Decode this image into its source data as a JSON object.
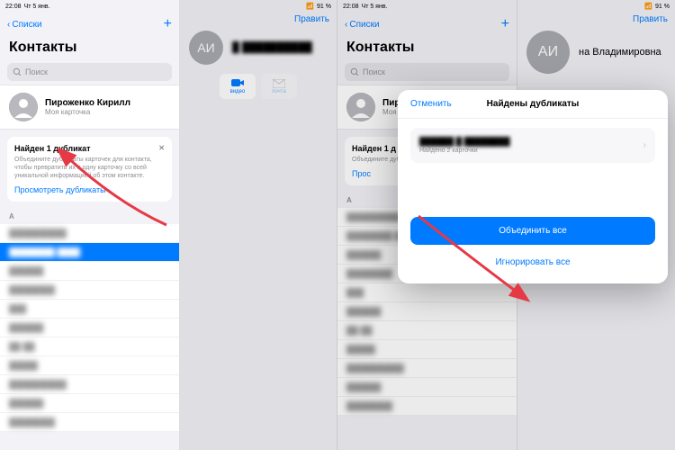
{
  "status": {
    "time": "22:08",
    "date": "Чт 5 янв.",
    "battery": "91 %"
  },
  "nav": {
    "back": "Списки",
    "plus": "+",
    "edit": "Править"
  },
  "title": "Контакты",
  "search": {
    "placeholder": "Поиск"
  },
  "mycard": {
    "name": "Пироженко Кирилл",
    "sub": "Моя карточка"
  },
  "dup": {
    "title": "Найден 1 дубликат",
    "desc": "Объедините дубликаты карточек для контакта, чтобы превратить их в одну карточку со всей уникальной информацией об этом контакте.",
    "link": "Просмотреть дубликаты",
    "title_partial": "Найден 1 д"
  },
  "section": "А",
  "avatar_initials": "АИ",
  "detail_name": "на Владимировна",
  "actions": {
    "video": "видео",
    "mail": "почта"
  },
  "modal": {
    "cancel": "Отменить",
    "title": "Найдены дубликаты",
    "sub": "Найдено 2 карточки",
    "primary": "Объединить все",
    "secondary": "Игнорировать все"
  },
  "contacts_blur": [
    "██████████",
    "████████ ████",
    "██████",
    "████████",
    "███",
    "██████",
    "██-██",
    "█████"
  ],
  "suffix_visible": "ровна"
}
